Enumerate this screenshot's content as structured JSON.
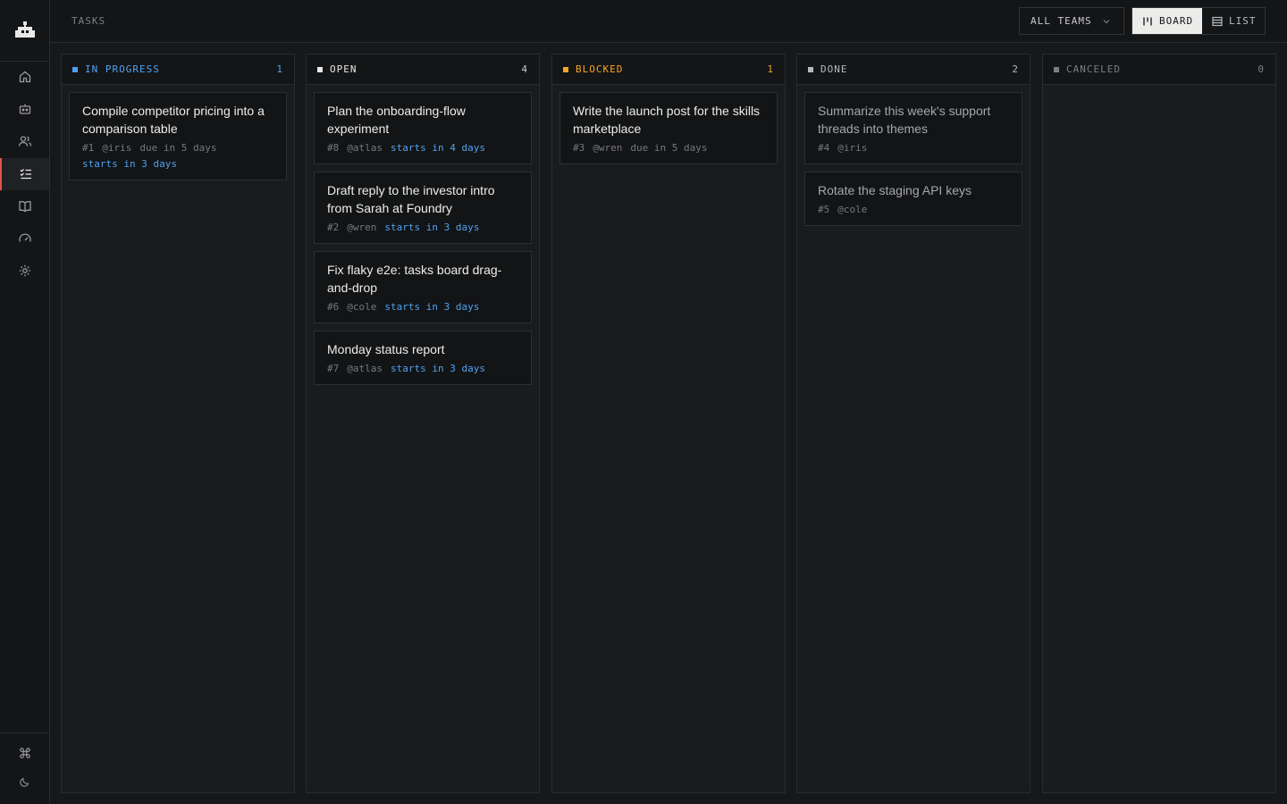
{
  "header": {
    "title": "TASKS",
    "team_filter": "ALL TEAMS",
    "view_board": "BOARD",
    "view_list": "LIST"
  },
  "sidebar": {
    "items": [
      {
        "name": "home-icon"
      },
      {
        "name": "bot-icon"
      },
      {
        "name": "users-icon"
      },
      {
        "name": "tasks-icon",
        "active": true
      },
      {
        "name": "book-icon"
      },
      {
        "name": "gauge-icon"
      },
      {
        "name": "gear-icon"
      }
    ],
    "bottom": [
      {
        "name": "command-icon"
      },
      {
        "name": "moon-icon"
      }
    ]
  },
  "colors": {
    "in_progress": "#4ea3f0",
    "open": "#e8e8e6",
    "blocked": "#f5a524",
    "done": "#b8b9bc",
    "canceled": "#7d7e82",
    "active_accent": "#e0564b"
  },
  "columns": [
    {
      "name": "IN PROGRESS",
      "count": "1",
      "cards": [
        {
          "title": "Compile competitor pricing into a comparison table",
          "id": "#1",
          "assignee": "@iris",
          "due": "due in 5 days",
          "starts": "starts in 3 days"
        }
      ]
    },
    {
      "name": "OPEN",
      "count": "4",
      "cards": [
        {
          "title": "Plan the onboarding-flow experiment",
          "id": "#8",
          "assignee": "@atlas",
          "starts": "starts in 4 days"
        },
        {
          "title": "Draft reply to the investor intro from Sarah at Foundry",
          "id": "#2",
          "assignee": "@wren",
          "starts": "starts in 3 days"
        },
        {
          "title": "Fix flaky e2e: tasks board drag-and-drop",
          "id": "#6",
          "assignee": "@cole",
          "starts": "starts in 3 days"
        },
        {
          "title": "Monday status report",
          "id": "#7",
          "assignee": "@atlas",
          "starts": "starts in 3 days"
        }
      ]
    },
    {
      "name": "BLOCKED",
      "count": "1",
      "cards": [
        {
          "title": "Write the launch post for the skills marketplace",
          "id": "#3",
          "assignee": "@wren",
          "due": "due in 5 days"
        }
      ]
    },
    {
      "name": "DONE",
      "count": "2",
      "cards": [
        {
          "title": "Summarize this week's support threads into themes",
          "id": "#4",
          "assignee": "@iris"
        },
        {
          "title": "Rotate the staging API keys",
          "id": "#5",
          "assignee": "@cole"
        }
      ]
    },
    {
      "name": "CANCELED",
      "count": "0",
      "cards": []
    }
  ]
}
